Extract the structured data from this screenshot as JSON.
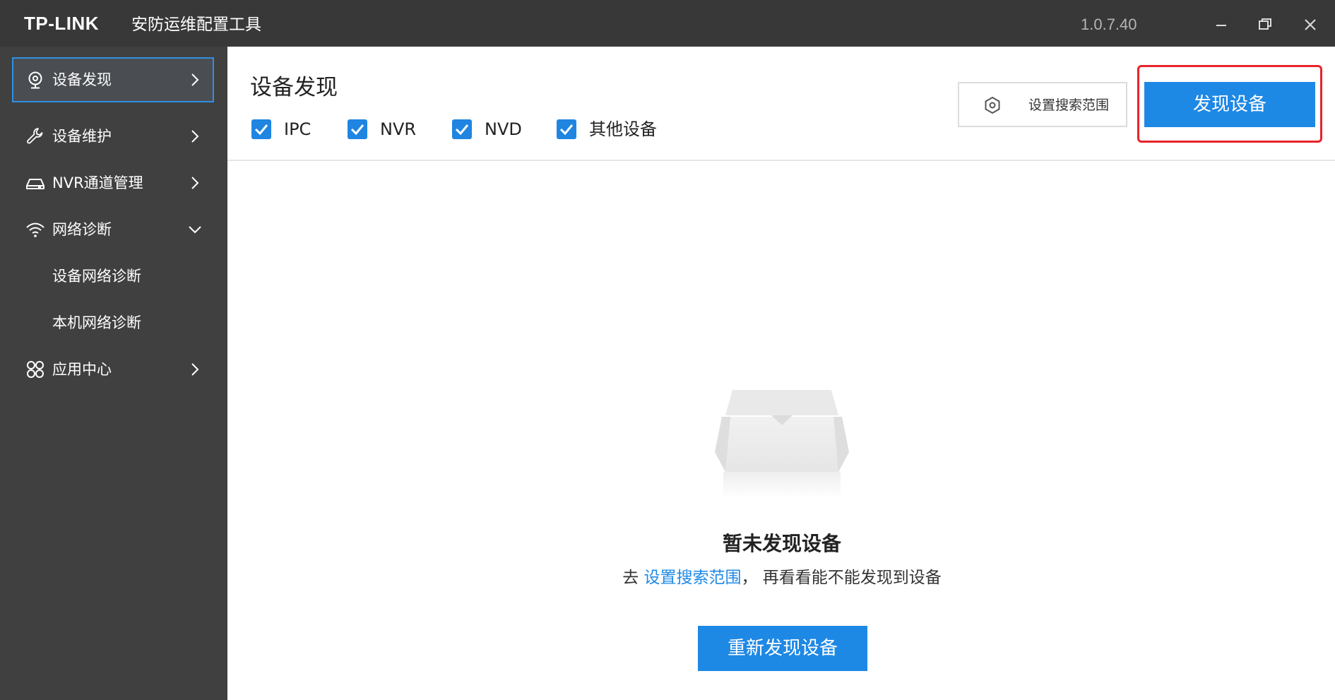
{
  "titlebar": {
    "brand": "TP-LINK",
    "app_title": "安防运维配置工具",
    "version": "1.0.7.40"
  },
  "sidebar": {
    "items": [
      {
        "label": "设备发现",
        "icon": "webcam-icon",
        "active": true
      },
      {
        "label": "设备维护",
        "icon": "wrench-icon"
      },
      {
        "label": "NVR通道管理",
        "icon": "nvr-device-icon"
      },
      {
        "label": "网络诊断",
        "icon": "wifi-icon",
        "expanded": true,
        "children": [
          {
            "label": "设备网络诊断"
          },
          {
            "label": "本机网络诊断"
          }
        ]
      },
      {
        "label": "应用中心",
        "icon": "app-grid-icon"
      }
    ]
  },
  "main": {
    "title": "设备发现",
    "filters": [
      {
        "label": "IPC",
        "checked": true
      },
      {
        "label": "NVR",
        "checked": true
      },
      {
        "label": "NVD",
        "checked": true
      },
      {
        "label": "其他设备",
        "checked": true
      }
    ],
    "range_button": "设置搜索范围",
    "discover_button": "发现设备"
  },
  "empty": {
    "title": "暂未发现设备",
    "hint_prefix": "去 ",
    "hint_link": "设置搜索范围",
    "hint_suffix": "， 再看看能不能发现到设备",
    "retry_button": "重新发现设备"
  },
  "colors": {
    "titlebar_bg": "#383838",
    "sidebar_bg": "#404040",
    "accent": "#1e88e5",
    "highlight": "#e8232b"
  }
}
